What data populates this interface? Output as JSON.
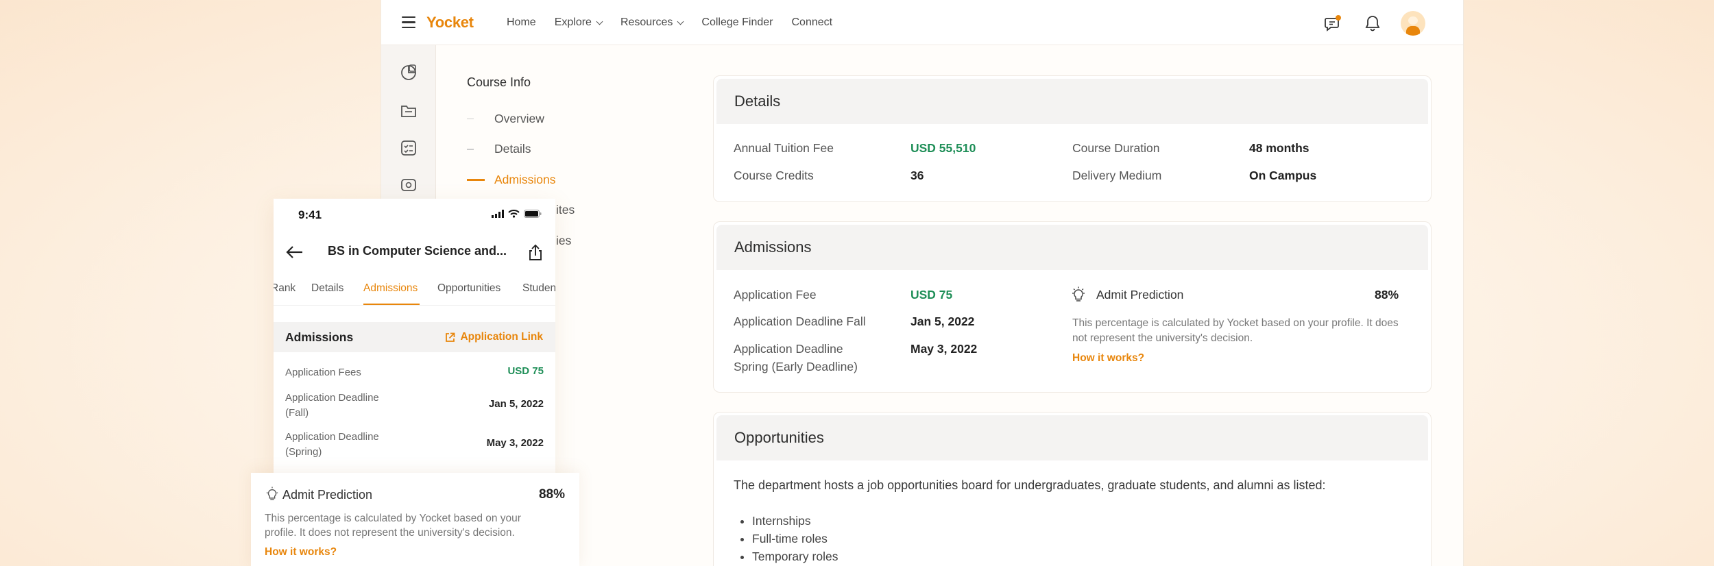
{
  "header": {
    "logo": "Yocket",
    "nav": [
      "Home",
      "Explore",
      "Resources",
      "College Finder",
      "Connect"
    ]
  },
  "course_info": {
    "title": "Course Info",
    "items": [
      "Overview",
      "Details",
      "Admissions",
      "ites",
      "ies"
    ]
  },
  "details": {
    "title": "Details",
    "tuition_label": "Annual Tuition Fee",
    "tuition_value": "USD 55,510",
    "credits_label": "Course Credits",
    "credits_value": "36",
    "duration_label": "Course Duration",
    "duration_value": "48 months",
    "medium_label": "Delivery Medium",
    "medium_value": "On Campus"
  },
  "admissions": {
    "title": "Admissions",
    "fee_label": "Application Fee",
    "fee_value": "USD 75",
    "fall_label": "Application Deadline Fall",
    "fall_value": "Jan 5, 2022",
    "spring_label_1": "Application Deadline",
    "spring_label_2": "Spring (Early Deadline)",
    "spring_value": "May 3, 2022",
    "prediction_label": "Admit Prediction",
    "prediction_value": "88%",
    "prediction_note_1": "This percentage is calculated by Yocket based on your profile. It does",
    "prediction_note_2": "not represent the university's decision.",
    "how_link": "How it works?"
  },
  "opportunities": {
    "title": "Opportunities",
    "text": "The department hosts a job opportunities board for undergraduates, graduate students, and alumni as listed:",
    "bullets": [
      "Internships",
      "Full-time roles",
      "Temporary roles"
    ]
  },
  "phone": {
    "time": "9:41",
    "title": "BS in Computer Science and...",
    "tabs": [
      "Rank",
      "Details",
      "Admissions",
      "Opportunities",
      "Studen"
    ],
    "section_title": "Admissions",
    "app_link": "Application Link",
    "fees_label": "Application Fees",
    "fees_value": "USD 75",
    "fall_label_1": "Application Deadline",
    "fall_label_2": "(Fall)",
    "fall_value": "Jan 5, 2022",
    "spring_label_1": "Application Deadline",
    "spring_label_2": "(Spring)",
    "spring_value": "May 3, 2022",
    "prediction_label": "Admit Prediction",
    "prediction_value": "88%",
    "note_1": "This percentage is calculated by Yocket based on your",
    "note_2": "profile. It does not represent the university's decision.",
    "how_link": "How it works?"
  },
  "colors": {
    "accent": "#e8860c",
    "green": "#1e8e57"
  }
}
